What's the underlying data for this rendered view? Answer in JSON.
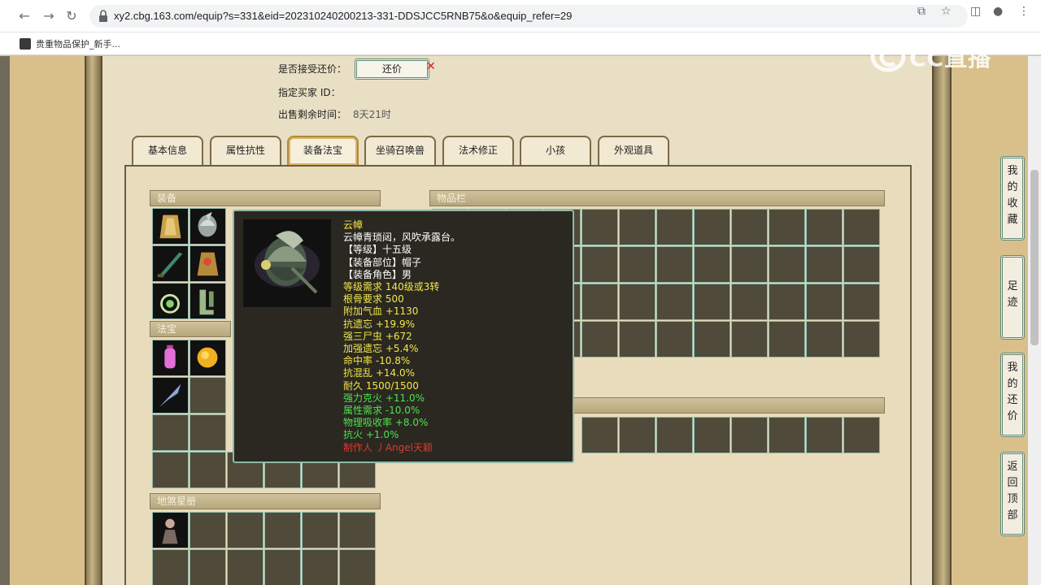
{
  "browser": {
    "url": "xy2.cbg.163.com/equip?s=331&eid=202310240200213-331-DDSJCC5RNB75&o&equip_refer=29",
    "bookmark": "贵重物品保护_新手..."
  },
  "watermark": {
    "text": "CC直播"
  },
  "info": {
    "accept_counter_label": "是否接受还价：",
    "counter_button": "还价",
    "buyer_id_label": "指定买家 ID：",
    "time_left_label": "出售剩余时间：",
    "time_left_value": "8天21时"
  },
  "tabs": [
    "基本信息",
    "属性抗性",
    "装备法宝",
    "坐骑召唤兽",
    "法术修正",
    "小孩",
    "外观道具"
  ],
  "active_tab": 2,
  "sections": {
    "equipment": "装备",
    "treasure": "法宝",
    "star_book": "地煞星册",
    "inventory": "物品栏"
  },
  "tooltip": {
    "lines": [
      {
        "text": "云幛",
        "color": "#f4e64a"
      },
      {
        "text": "云幛青琐闼，风吹承露台。",
        "color": "#ffffff"
      },
      {
        "text": "【等级】十五级",
        "color": "#ffffff"
      },
      {
        "text": "【装备部位】帽子",
        "color": "#ffffff"
      },
      {
        "text": "【装备角色】男",
        "color": "#ffffff"
      },
      {
        "text": "等级需求 140级或3转",
        "color": "#f4e64a"
      },
      {
        "text": "根骨要求 500",
        "color": "#f4e64a"
      },
      {
        "text": "附加气血 +1130",
        "color": "#f4e64a"
      },
      {
        "text": "抗遗忘 +19.9%",
        "color": "#f4e64a"
      },
      {
        "text": "强三尸虫 +672",
        "color": "#f4e64a"
      },
      {
        "text": "加强遗忘 +5.4%",
        "color": "#f4e64a"
      },
      {
        "text": "命中率 -10.8%",
        "color": "#f4e64a"
      },
      {
        "text": "抗混乱 +14.0%",
        "color": "#f4e64a"
      },
      {
        "text": "耐久 1500/1500",
        "color": "#f4e64a"
      },
      {
        "text": "强力克火 +11.0%",
        "color": "#4ee34e"
      },
      {
        "text": "属性需求 -10.0%",
        "color": "#4ee34e"
      },
      {
        "text": "物理吸收率 +8.0%",
        "color": "#4ee34e"
      },
      {
        "text": "抗火 +1.0%",
        "color": "#4ee34e"
      },
      {
        "text": "制作人 丿Angel天颖",
        "color": "#e03a2f"
      }
    ]
  },
  "side_buttons": [
    "我的收藏",
    "足迹",
    "我的还价",
    "返回顶部"
  ]
}
